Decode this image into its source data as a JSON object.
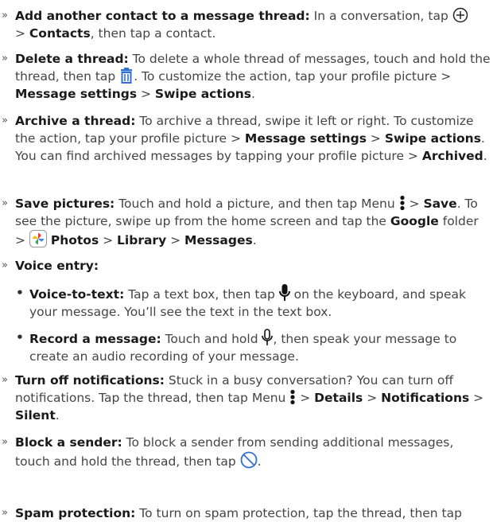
{
  "bullets": {
    "chevron": "»",
    "dot": "•"
  },
  "items": [
    {
      "title": "Add another contact to a message thread:",
      "t1": " In a conversation, tap ",
      "t2": "> ",
      "b1": "Contacts",
      "t3": ", then tap a contact."
    },
    {
      "title": "Delete a thread:",
      "t1": " To delete a whole thread of messages, touch and hold the thread, then tap ",
      "t2": ". To customize the action, tap your profile picture > ",
      "b1": "Message settings",
      "t3": " > ",
      "b2": "Swipe actions",
      "t4": "."
    },
    {
      "title": "Archive a thread:",
      "t1": " To archive a thread, swipe it left or right. To customize the action, tap your profile picture > ",
      "b1": "Message settings",
      "t2": " > ",
      "b2": "Swipe actions",
      "t3": ". You can find archived messages by tapping your profile picture > ",
      "b3": "Archived",
      "t4": "."
    },
    {
      "title": "Save pictures:",
      "t1": " Touch and hold a picture, and then tap Menu ",
      "t2": " > ",
      "b1": "Save",
      "t3": ". To see the picture, swipe up from the home screen and tap the ",
      "b2": "Google",
      "t4": " folder > ",
      "b3": "Photos",
      "t5": " > ",
      "b4": "Library",
      "t6": " > ",
      "b5": "Messages",
      "t7": "."
    },
    {
      "title": "Voice entry:"
    },
    {
      "title": "Turn off notifications:",
      "t1": " Stuck in a busy conversation? You can turn off notifications. Tap the thread, then tap Menu ",
      "t2": " > ",
      "b1": "Details",
      "t3": " > ",
      "b2": "Notifications",
      "t4": " > ",
      "b3": "Silent",
      "t5": "."
    },
    {
      "title": "Block a sender:",
      "t1": " To block a sender from sending additional messages, touch and hold the thread, then tap ",
      "t2": "."
    },
    {
      "title": "Spam protection:",
      "t1": " To turn on spam protection, tap the thread, then tap"
    }
  ],
  "voice": [
    {
      "title": "Voice-to-text:",
      "t1": " Tap a text box, then tap ",
      "t2": " on the keyboard, and speak your message. You’ll see the text in the text box."
    },
    {
      "title": "Record a message:",
      "t1": " Touch and hold ",
      "t2": ", then speak your message to create an audio recording of your message."
    }
  ],
  "icons": {
    "add_contact": "add-circle-icon",
    "delete": "trash-icon",
    "menu": "more-vertical-icon",
    "photos": "google-photos-icon",
    "mic": "microphone-icon",
    "mic_outline": "microphone-outline-icon",
    "block": "block-icon"
  },
  "colors": {
    "text": "#444444",
    "bold": "#1a1a1a"
  }
}
